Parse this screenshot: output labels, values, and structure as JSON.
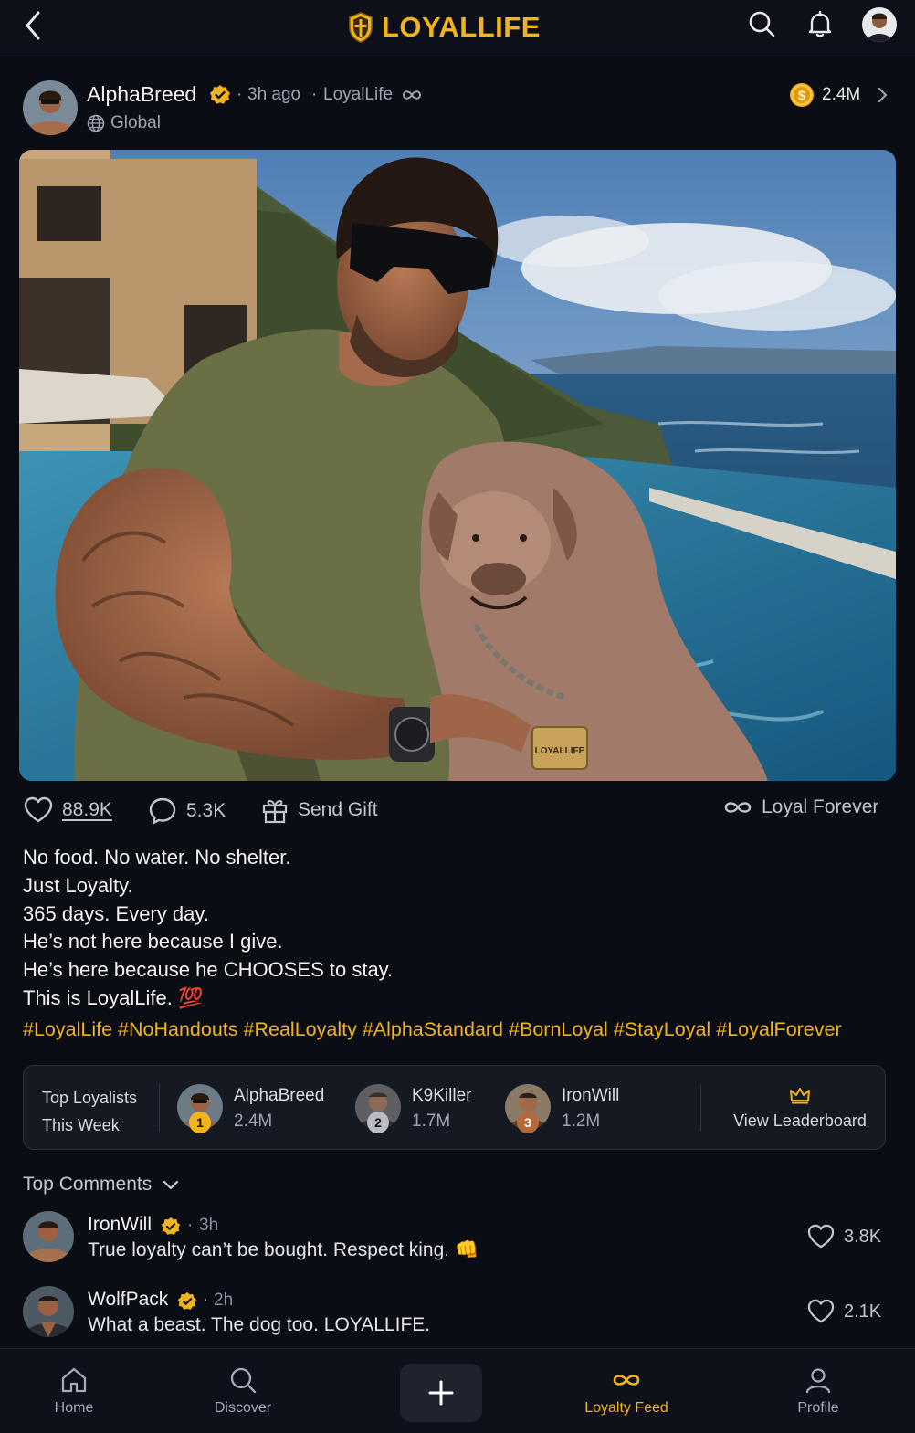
{
  "header": {
    "brand": "LOYALLIFE",
    "icons": [
      "back-icon",
      "shield-logo-icon",
      "search-icon",
      "bell-icon",
      "avatar"
    ],
    "accent_color": "#f2b321"
  },
  "post": {
    "author": "AlphaBreed",
    "time": "3h ago",
    "community": "LoyalLife",
    "audience": "Global",
    "coins": "2.4M",
    "image_tag": "LOYALLIFE",
    "likes": "88.9K",
    "comments": "5.3K",
    "gift_label": "Send Gift",
    "loyal_label": "Loyal Forever",
    "caption": [
      "No food. No water. No shelter.",
      "Just Loyalty.",
      "365 days. Every day.",
      "He’s not here because I give.",
      "He’s here because he CHOOSES to stay.",
      "This is LoyalLife. 💯"
    ],
    "hashtags": [
      "#LoyalLife",
      "#NoHandouts",
      "#RealLoyalty",
      "#AlphaStandard",
      "#BornLoyal",
      "#StayLoyal",
      "#LoyalForever"
    ]
  },
  "leaderboard": {
    "title_line1": "Top Loyalists",
    "title_line2": "This Week",
    "users": [
      {
        "rank": "1",
        "name": "AlphaBreed",
        "value": "2.4M"
      },
      {
        "rank": "2",
        "name": "K9Killer",
        "value": "1.7M"
      },
      {
        "rank": "3",
        "name": "IronWill",
        "value": "1.2M"
      }
    ],
    "view_label": "View Leaderboard"
  },
  "comments": {
    "heading": "Top Comments",
    "items": [
      {
        "name": "IronWill",
        "time": "3h",
        "text": "True loyalty can’t be bought. Respect king. 👊",
        "likes": "3.8K"
      },
      {
        "name": "WolfPack",
        "time": "2h",
        "text": "What a beast. The dog too. LOYALLIFE.",
        "likes": "2.1K"
      }
    ]
  },
  "nav": {
    "home": "Home",
    "discover": "Discover",
    "feed": "Loyalty Feed",
    "profile": "Profile"
  }
}
